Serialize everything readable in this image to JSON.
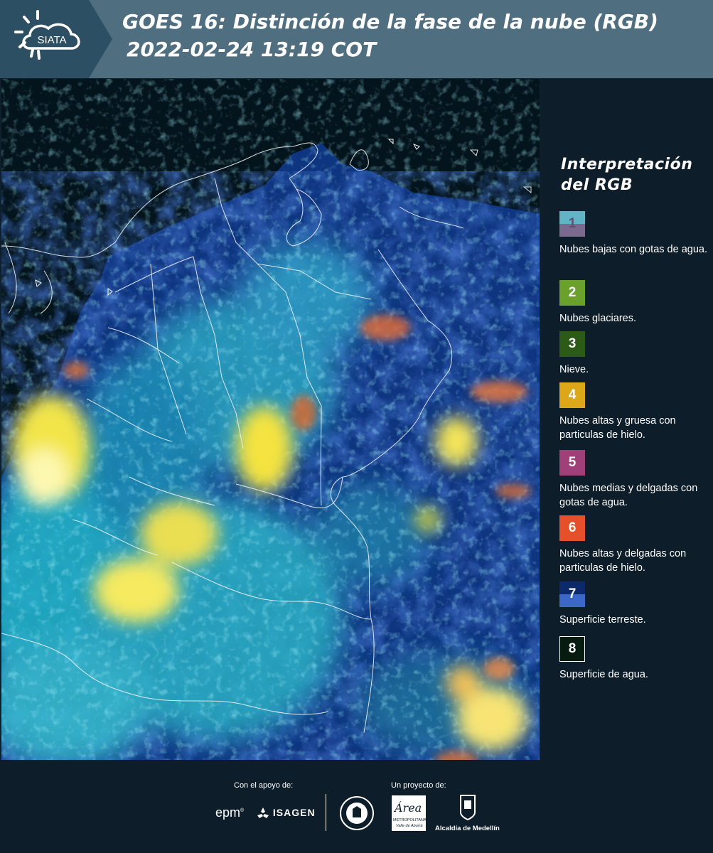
{
  "header": {
    "logo_text": "SIATA",
    "title_line1": "GOES 16: Distinción de la fase de la nube (RGB)",
    "title_line2": "2022-02-24 13:19 COT"
  },
  "legend": {
    "title": "Interpretación del RGB",
    "items": [
      {
        "number": "1",
        "label": "Nubes bajas con gotas de agua.",
        "color_top": "#63b3c6",
        "color_bottom": "#7a6b8e"
      },
      {
        "number": "2",
        "label": "Nubes glaciares.",
        "color_top": "#6aa12c",
        "color_bottom": "#6aa12c"
      },
      {
        "number": "3",
        "label": "Nieve.",
        "color_top": "#2c5a17",
        "color_bottom": "#2c5a17"
      },
      {
        "number": "4",
        "label": "Nubes altas y gruesa con particulas de hielo.",
        "color_top": "#dca81a",
        "color_bottom": "#dca81a"
      },
      {
        "number": "5",
        "label": "Nubes medias y delgadas con gotas de agua.",
        "color_top": "#a04078",
        "color_bottom": "#a04078"
      },
      {
        "number": "6",
        "label": "Nubes altas y delgadas con particulas de hielo.",
        "color_top": "#e5502a",
        "color_bottom": "#e5502a"
      },
      {
        "number": "7",
        "label": "Superficie terreste.",
        "color_top": "#0c2a6b",
        "color_bottom": "#3b67c6"
      },
      {
        "number": "8",
        "label": "Superficie de agua.",
        "color_top": "#071b0e",
        "color_bottom": "#071b0e"
      }
    ]
  },
  "footer": {
    "support_caption": "Con el apoyo de:",
    "project_caption": "Un proyecto de:",
    "sponsor_epm": "epm",
    "sponsor_isagen": "ISAGEN",
    "partner_area_line1": "METROPOLITANA",
    "partner_area_line2": "Valle de Aburrá",
    "partner_alcaldia": "Alcaldía de Medellín"
  }
}
